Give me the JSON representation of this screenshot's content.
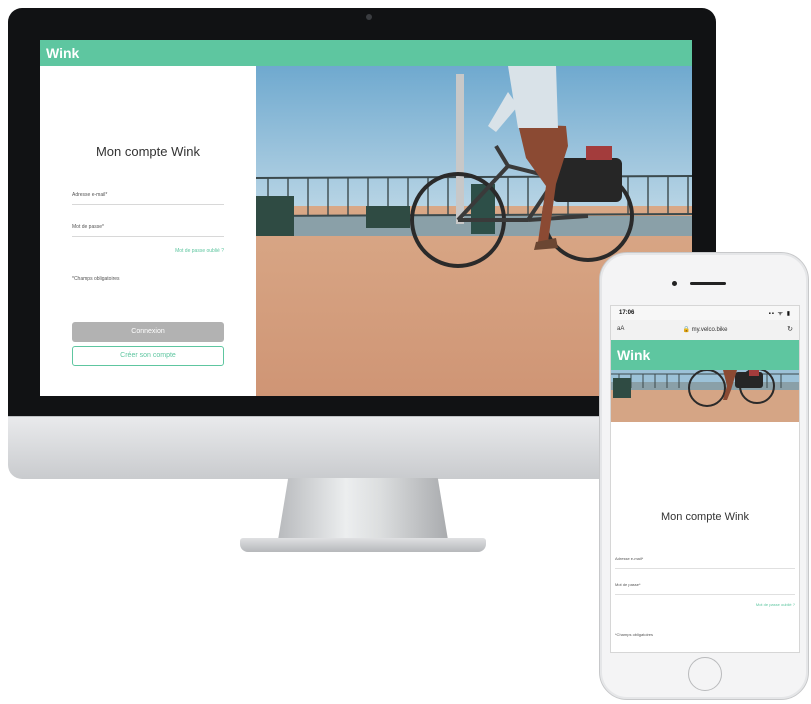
{
  "brand": {
    "name": "Wink",
    "accent": "#5ec6a0"
  },
  "desktop": {
    "title": "Mon compte Wink",
    "email_label": "Adresse e-mail*",
    "password_label": "Mot de passe*",
    "forgot_link": "Mot de passe oublié ?",
    "required_note": "*Champs obligatoires",
    "connect_button": "Connexion",
    "create_account_button": "Créer son compte"
  },
  "phone": {
    "status_time": "17:06",
    "status_icons": "▪▪ ᯤ ▮",
    "url_aa": "aA",
    "url": "🔒 my.velco.bike",
    "reload_icon": "↻",
    "title": "Mon compte Wink",
    "email_label": "Adresse e-mail*",
    "password_label": "Mot de passe*",
    "forgot_link": "Mot de passe oublié ?",
    "required_note": "*Champs obligatoires"
  },
  "icons": {
    "lock": "lock-icon",
    "reload": "reload-icon",
    "signal": "signal-icon",
    "wifi": "wifi-icon",
    "battery": "battery-icon"
  }
}
